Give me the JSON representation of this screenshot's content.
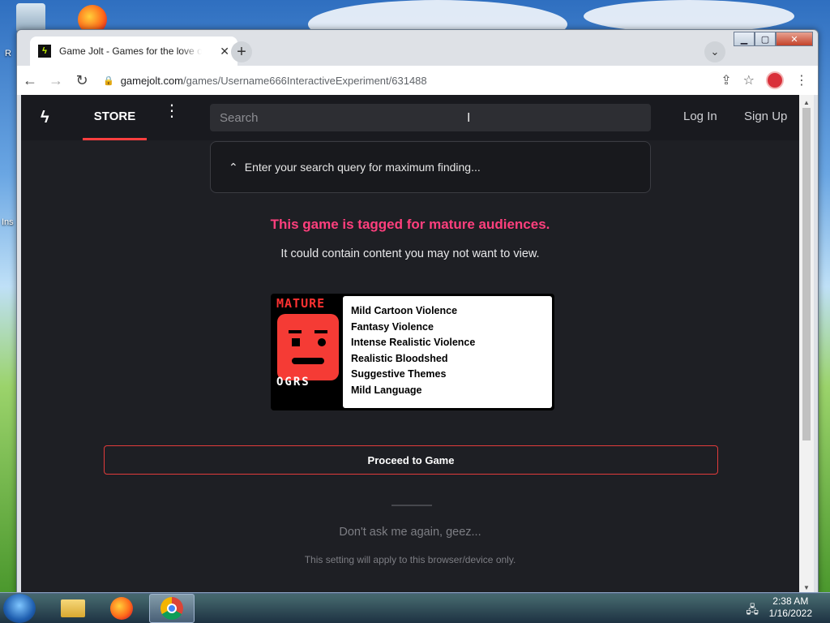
{
  "desktop": {
    "recycle_label": "R",
    "installer_label": "Ins"
  },
  "browser": {
    "tab": {
      "title": "Game Jolt - Games for the love of it",
      "favicon_glyph": "ϟ",
      "close_glyph": "✕"
    },
    "new_tab_glyph": "+",
    "tab_search_glyph": "⌄",
    "window_controls": {
      "minimize": "▁",
      "maximize": "▢",
      "close": "✕"
    },
    "toolbar": {
      "back_glyph": "←",
      "forward_glyph": "→",
      "reload_glyph": "↻",
      "url_host": "gamejolt.com",
      "url_path": "/games/Username666InteractiveExperiment/631488",
      "share_glyph": "⇪",
      "bookmark_glyph": "☆",
      "menu_glyph": "⋮"
    }
  },
  "site": {
    "logo_glyph": "ϟ",
    "nav": {
      "store_label": "STORE",
      "more_glyph": "⋮",
      "search_placeholder": "Search",
      "login_label": "Log In",
      "signup_label": "Sign Up"
    },
    "search_hint": {
      "caret_glyph": "⌃",
      "text": "Enter your search query for maximum finding..."
    },
    "maturity": {
      "title": "This game is tagged for mature audiences.",
      "subtitle": "It could contain content you may not want to view.",
      "rating_logo_top": "MATURE",
      "rating_logo_bottom": "OGRS",
      "descriptors": [
        "Mild Cartoon Violence",
        "Fantasy Violence",
        "Intense Realistic Violence",
        "Realistic Bloodshed",
        "Suggestive Themes",
        "Mild Language"
      ],
      "proceed_label": "Proceed to Game",
      "dont_ask_label": "Don't ask me again, geez...",
      "setting_note": "This setting will apply to this browser/device only."
    }
  },
  "taskbar": {
    "time": "2:38 AM",
    "date": "1/16/2022",
    "network_glyph": "🖧"
  },
  "colors": {
    "accent_red": "#ff3f3f",
    "warning_pink": "#ff3f7d",
    "page_bg": "#1e1f24"
  }
}
